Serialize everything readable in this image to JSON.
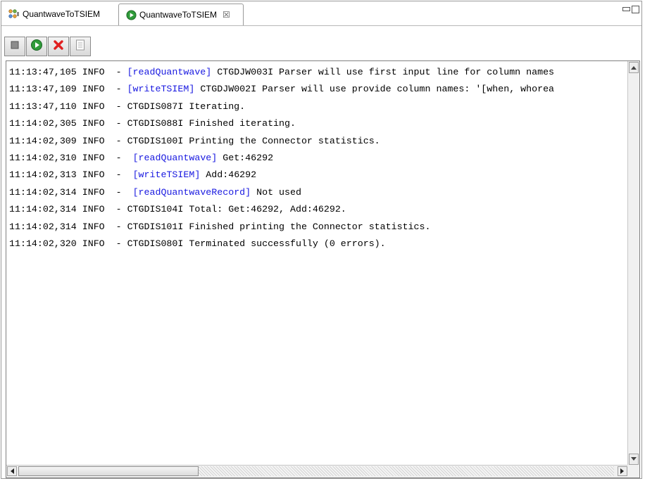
{
  "tabs": [
    {
      "label": "QuantwaveToTSIEM",
      "icon": "assembly-line-icon",
      "active": false
    },
    {
      "label": "QuantwaveToTSIEM",
      "icon": "run-status-icon",
      "active": true,
      "close_glyph": "☒"
    }
  ],
  "toolbar": [
    {
      "name": "stop-icon"
    },
    {
      "name": "run-icon"
    },
    {
      "name": "terminate-icon"
    },
    {
      "name": "clear-log-icon"
    }
  ],
  "log": [
    {
      "ts": "11:13:47,105 INFO  - ",
      "link": "[readQuantwave]",
      "text": " CTGDJW003I Parser will use first input line for column names"
    },
    {
      "ts": "11:13:47,109 INFO  - ",
      "link": "[writeTSIEM]",
      "text": " CTGDJW002I Parser will use provide column names: '[when, whorea"
    },
    {
      "ts": "11:13:47,110 INFO  - ",
      "link": "",
      "text": "CTGDIS087I Iterating."
    },
    {
      "ts": "11:14:02,305 INFO  - ",
      "link": "",
      "text": "CTGDIS088I Finished iterating."
    },
    {
      "ts": "11:14:02,309 INFO  - ",
      "link": "",
      "text": "CTGDIS100I Printing the Connector statistics."
    },
    {
      "ts": "11:14:02,310 INFO  -  ",
      "link": "[readQuantwave]",
      "text": " Get:46292"
    },
    {
      "ts": "11:14:02,313 INFO  -  ",
      "link": "[writeTSIEM]",
      "text": " Add:46292"
    },
    {
      "ts": "11:14:02,314 INFO  -  ",
      "link": "[readQuantwaveRecord]",
      "text": " Not used"
    },
    {
      "ts": "11:14:02,314 INFO  - ",
      "link": "",
      "text": "CTGDIS104I Total: Get:46292, Add:46292."
    },
    {
      "ts": "11:14:02,314 INFO  - ",
      "link": "",
      "text": "CTGDIS101I Finished printing the Connector statistics."
    },
    {
      "ts": "11:14:02,320 INFO  - ",
      "link": "",
      "text": "CTGDIS080I Terminated successfully (0 errors)."
    }
  ],
  "colors": {
    "link": "#1818e0"
  }
}
